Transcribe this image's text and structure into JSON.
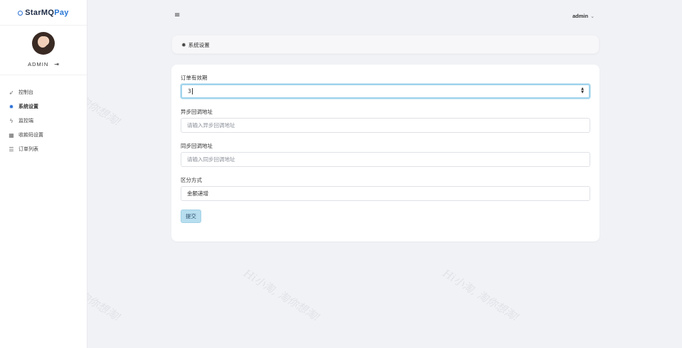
{
  "logo": {
    "part1": "StarMQ",
    "part2": "Pay"
  },
  "profile": {
    "name": "ADMIN",
    "logout_icon": "logout-icon"
  },
  "nav": [
    {
      "label": "控制台",
      "icon": "rocket-icon"
    },
    {
      "label": "系统设置",
      "icon": "gear-icon",
      "active": true
    },
    {
      "label": "监控端",
      "icon": "bolt-icon"
    },
    {
      "label": "收款码设置",
      "icon": "grid-icon"
    },
    {
      "label": "订单列表",
      "icon": "list-icon"
    }
  ],
  "topbar": {
    "menu_icon": "hamburger-icon",
    "user": "admin"
  },
  "breadcrumb": {
    "title": "系统设置"
  },
  "form": {
    "order_validity": {
      "label": "订单有效期",
      "value": "3"
    },
    "async_callback": {
      "label": "异步回调地址",
      "placeholder": "请输入异步回调地址"
    },
    "sync_callback": {
      "label": "同步回调地址",
      "placeholder": "请输入同步回调地址"
    },
    "distinguish": {
      "label": "区分方式",
      "value": "金额递增"
    },
    "submit_label": "提交"
  },
  "watermark": "Hi小淘, 淘你想淘!",
  "colors": {
    "accent": "#2a78d6",
    "button": "#b7deef",
    "background": "#f1f2f6"
  }
}
